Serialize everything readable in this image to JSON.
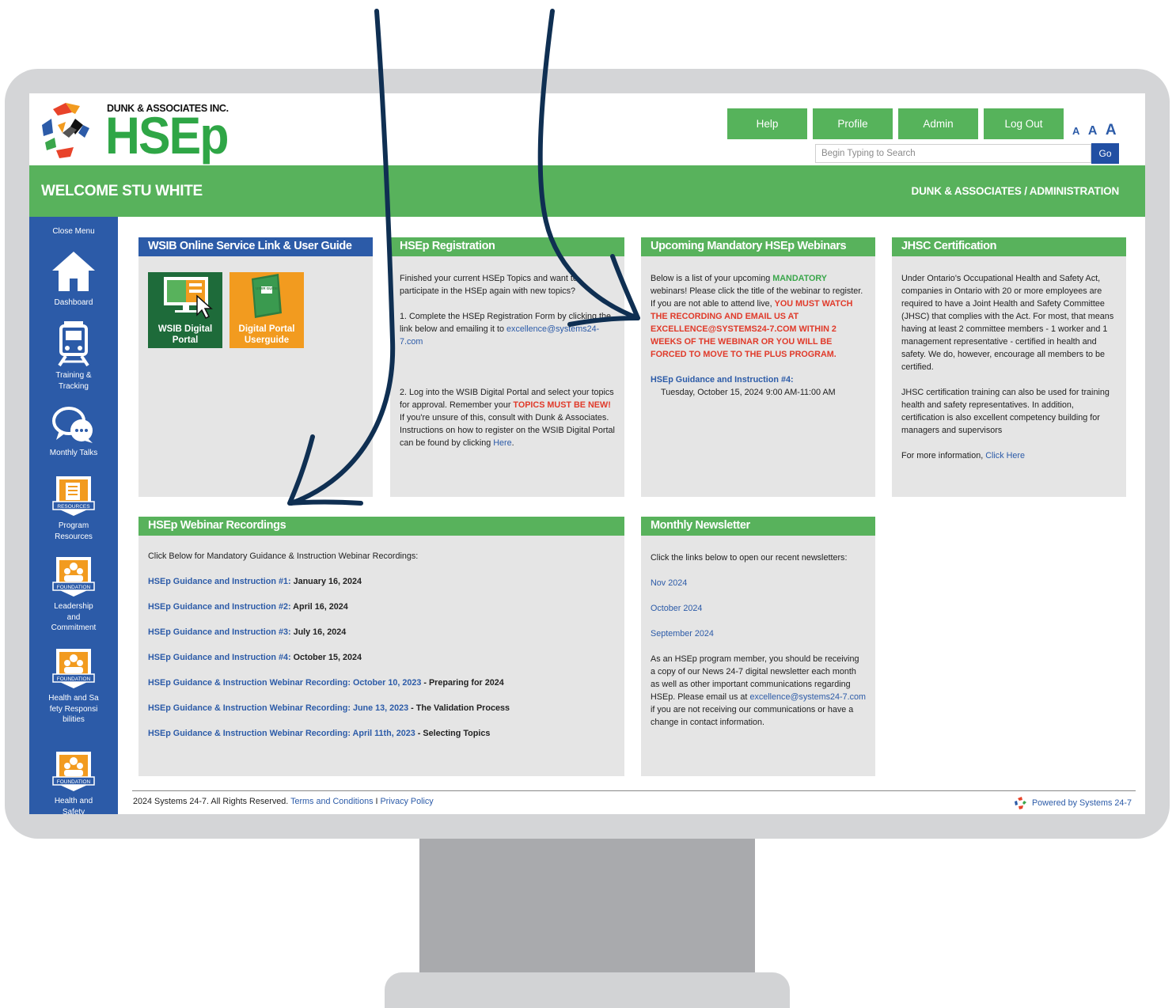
{
  "header": {
    "company": "DUNK & ASSOCIATES INC.",
    "product": "HSEp",
    "buttons": [
      "Help",
      "Profile",
      "Admin",
      "Log Out"
    ],
    "font_sizes": [
      "A",
      "A",
      "A"
    ],
    "search_placeholder": "Begin Typing to Search",
    "search_button": "Go"
  },
  "welcome": {
    "left": "WELCOME STU WHITE",
    "right": "DUNK & ASSOCIATES / ADMINISTRATION"
  },
  "sidebar": {
    "close_menu": "Close Menu",
    "items": [
      {
        "label": "Dashboard",
        "icon": "home-icon"
      },
      {
        "label": "Training & Tracking",
        "icon": "train-icon"
      },
      {
        "label": "Monthly Talks",
        "icon": "chat-icon"
      },
      {
        "label": "Program Resources",
        "icon": "resources-icon",
        "badge": "RESOURCES"
      },
      {
        "label": "Leadership and Commitment",
        "icon": "foundation-icon",
        "badge": "FOUNDATION"
      },
      {
        "label": "Health and Safety Responsibilities",
        "icon": "foundation-icon",
        "badge": "FOUNDATION"
      },
      {
        "label": "Health and Safety",
        "icon": "foundation-icon",
        "badge": "FOUNDATION"
      }
    ]
  },
  "panels": {
    "wsib": {
      "title": "WSIB Online Service Link & User Guide",
      "tile1": "WSIB Digital Portal",
      "tile2": "Digital Portal Userguide",
      "tile2_book_text": "USER GUIDE"
    },
    "registration": {
      "title": "HSEp Registration",
      "p1": "Finished your current HSEp Topics and want to participate in the HSEp again with new topics?",
      "p2": "1. Complete the HSEp Registration Form by clicking the link below and emailing it to",
      "email": "excellence@systems24-7.com",
      "p3_a": "2. Log into the WSIB Digital Portal and select your topics for approval. Remember your",
      "p3_red": "TOPICS MUST BE NEW!",
      "p3_b": "If you're unsure of this, consult with Dunk & Associates. Instructions on how to register on the WSIB Digital Portal can be found by clicking",
      "p3_link": "Here",
      "p3_end": "."
    },
    "webinars": {
      "title": "Upcoming Mandatory HSEp Webinars",
      "intro_a": "Below is a list of your upcoming",
      "intro_green": "MANDATORY",
      "intro_b": "webinars! Please click the title of the webinar to register.  If you are not able to attend live,",
      "warning": "YOU MUST WATCH THE RECORDING AND EMAIL US AT EXCELLENCE@SYSTEMS24-7.COM WITHIN 2 WEEKS OF THE WEBINAR OR YOU WILL BE FORCED TO MOVE TO THE PLUS PROGRAM.",
      "next_title": "HSEp Guidance and Instruction #4:",
      "next_date": "Tuesday, October 15, 2024 9:00 AM-11:00 AM"
    },
    "jhsc": {
      "title": "JHSC Certification",
      "p1": "Under Ontario's Occupational Health and Safety Act, companies in Ontario with 20 or more employees are required to have a Joint Health and Safety Committee (JHSC) that complies with the Act. For most, that means having at least 2 committee members - 1 worker and 1 management representative - certified in health and safety. We do, however, encourage all members to be certified.",
      "p2": "JHSC certification training can also be used for training health and safety representatives. In addition, certification is also excellent competency building for managers and supervisors",
      "p3": "For more information,",
      "p3_link": "Click Here"
    },
    "recordings": {
      "title": "HSEp Webinar Recordings",
      "intro": "Click Below for Mandatory Guidance & Instruction Webinar Recordings:",
      "items": [
        {
          "link": "HSEp Guidance and Instruction #1:",
          "tail": " January 16, 2024"
        },
        {
          "link": "HSEp Guidance and Instruction #2:",
          "tail": " April 16, 2024"
        },
        {
          "link": "HSEp Guidance and Instruction #3:",
          "tail": " July 16, 2024"
        },
        {
          "link": "HSEp Guidance and Instruction #4:",
          "tail": " October 15, 2024"
        },
        {
          "link": "HSEp Guidance & Instruction Webinar  Recording: October 10, 2023",
          "tail": " - Preparing for 2024"
        },
        {
          "link": "HSEp Guidance & Instruction Webinar Recording: June 13, 2023",
          "tail": " - The Validation Process"
        },
        {
          "link": "HSEp Guidance & Instruction Webinar Recording: April 11th, 2023",
          "tail": " - Selecting Topics"
        }
      ]
    },
    "newsletter": {
      "title": "Monthly Newsletter",
      "intro": "Click the links below to open our recent newsletters:",
      "links": [
        "Nov 2024",
        "October 2024",
        "September 2024"
      ],
      "p_a": "As an HSEp program member, you should be receiving a copy of our News 24-7 digital newsletter each month as well as other important communications regarding HSEp. Please email us at",
      "email": "excellence@systems24-7.com",
      "p_b": "if you are not receiving our communications or have a change in contact information."
    }
  },
  "footer": {
    "copyright": "2024 Systems 24-7. All Rights Reserved.",
    "terms": "Terms and Conditions",
    "sep": "I",
    "privacy": "Privacy Policy",
    "powered": "Powered by Systems 24-7"
  },
  "colors": {
    "brand_green": "#58b25c",
    "brand_blue": "#2c5ba8",
    "alert_red": "#e03a2a",
    "arrow_navy": "#0f2f52"
  }
}
